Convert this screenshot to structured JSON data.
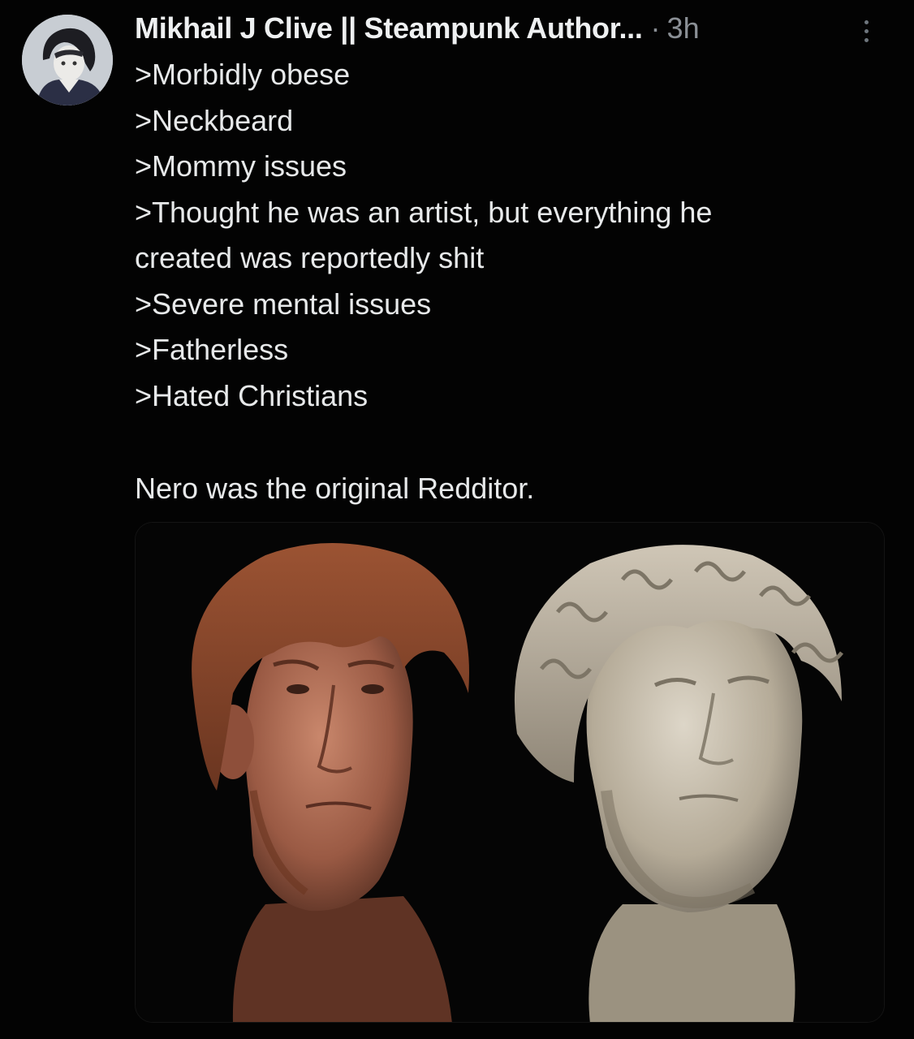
{
  "author": {
    "name": "Mikhail J Clive || Steampunk Author...",
    "time": "3h"
  },
  "tweet": {
    "lines": [
      ">Morbidly obese",
      ">Neckbeard",
      ">Mommy issues",
      ">Thought he was an artist, but everything he",
      "created was reportedly shit",
      ">Severe mental issues",
      ">Fatherless",
      ">Hated Christians"
    ],
    "closing": "Nero was the original Redditor."
  },
  "icons": {
    "more": "more-vertical-icon"
  },
  "colors": {
    "background": "#030303",
    "text": "#e7e9ea",
    "muted": "#8b9096"
  }
}
